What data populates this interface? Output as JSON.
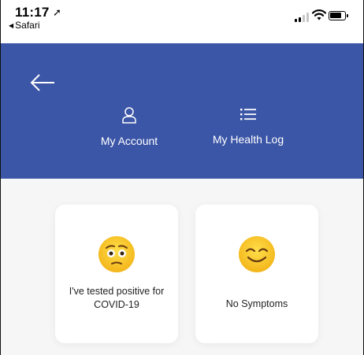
{
  "status_bar": {
    "time": "11:17",
    "back_app": "Safari"
  },
  "header": {
    "back_icon": "arrow-left-icon",
    "nav": [
      {
        "label": "My Account",
        "icon": "user-icon"
      },
      {
        "label": "My Health Log",
        "icon": "list-icon"
      }
    ],
    "background_color": "#3b55a7"
  },
  "options": [
    {
      "label": "I've tested positive for COVID-19",
      "icon": "worried-face-icon"
    },
    {
      "label": "No Symptoms",
      "icon": "smiling-face-icon"
    }
  ]
}
